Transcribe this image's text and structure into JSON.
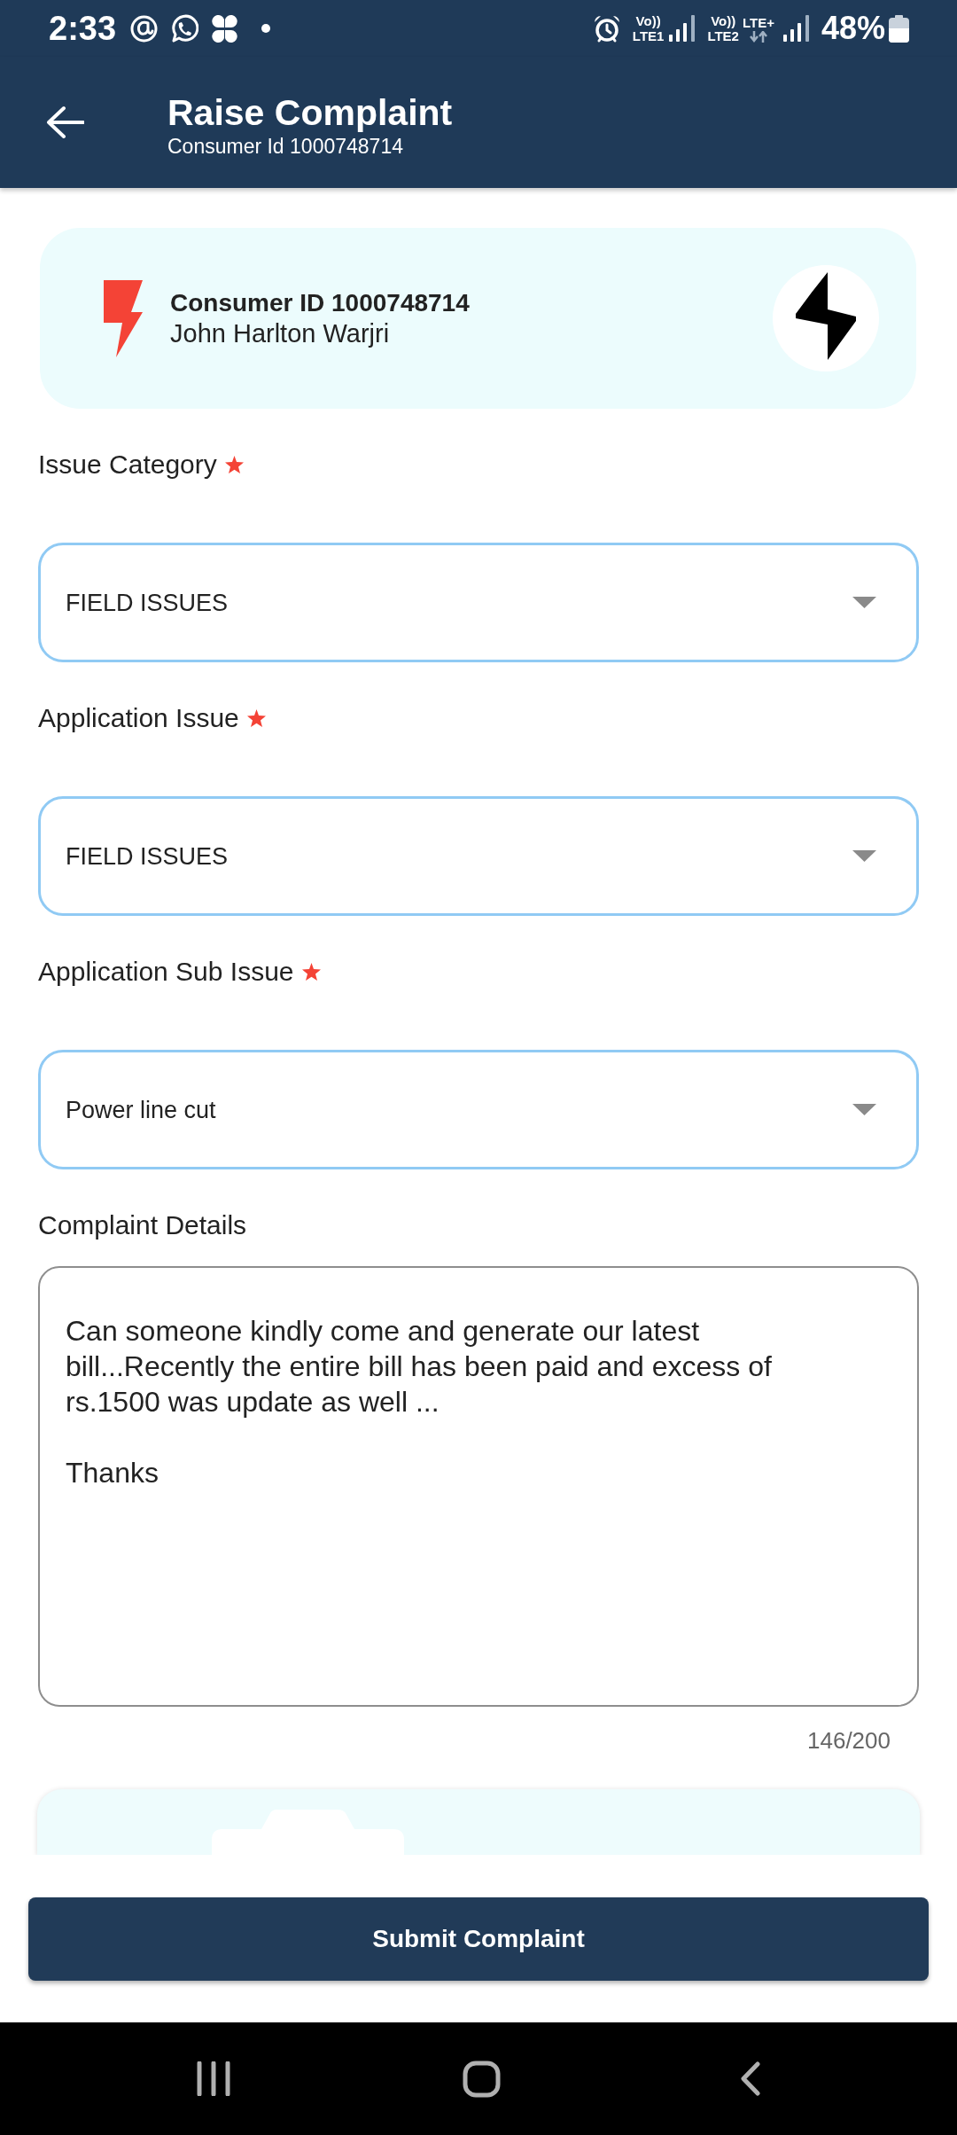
{
  "status_bar": {
    "time": "2:33",
    "sims": [
      {
        "voice": "Vo))",
        "network": "LTE1"
      },
      {
        "voice": "Vo))",
        "network": "LTE2",
        "data_type": "LTE+"
      }
    ],
    "battery": "48%"
  },
  "app_bar": {
    "title": "Raise Complaint",
    "subtitle": "Consumer Id 1000748714"
  },
  "consumer_card": {
    "consumer_id": "Consumer ID 1000748714",
    "name": "John Harlton Warjri"
  },
  "fields": [
    {
      "kind": "dropdown",
      "label": "Issue Category",
      "required": true,
      "value": "FIELD ISSUES"
    },
    {
      "kind": "dropdown",
      "label": "Application Issue",
      "required": true,
      "value": "FIELD ISSUES"
    },
    {
      "kind": "dropdown",
      "label": "Application Sub Issue",
      "required": true,
      "value": "Power line cut"
    },
    {
      "kind": "textarea",
      "label": "Complaint Details",
      "required": false,
      "value": "Can someone kindly come and generate our latest bill...Recently the entire bill has been paid and excess of rs.1500 was update as well ...\n\nThanks",
      "counter": "146/200"
    }
  ],
  "submit_button": {
    "label": "Submit Complaint"
  }
}
